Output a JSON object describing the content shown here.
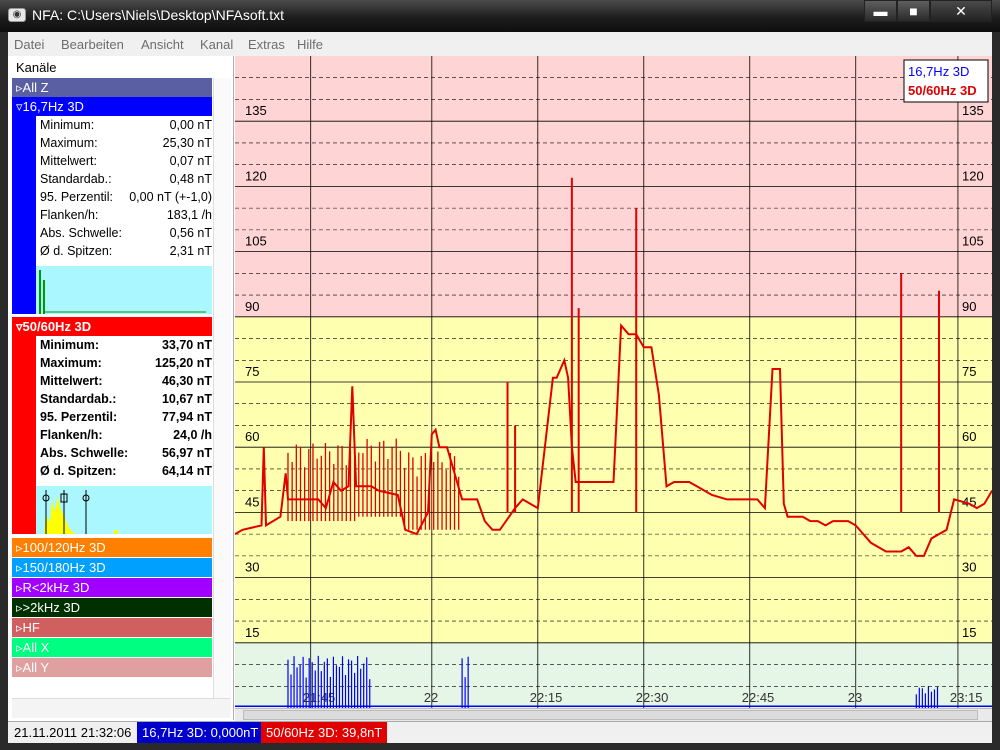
{
  "window": {
    "title": "NFA: C:\\Users\\Niels\\Desktop\\NFAsoft.txt",
    "min_glyph": "▬",
    "max_glyph": "■",
    "close_glyph": "✕"
  },
  "menu": [
    "Datei",
    "Bearbeiten",
    "Ansicht",
    "Kanal",
    "Extras",
    "Hilfe"
  ],
  "sidebar": {
    "header": "Kanäle",
    "channels": [
      {
        "label": "▹All Z",
        "color": "#5a5fa3"
      },
      {
        "label": "▿16,7Hz 3D",
        "color": "#0000ff",
        "expanded": true,
        "stats": [
          [
            "Minimum:",
            "0,00 nT"
          ],
          [
            "Maximum:",
            "25,30 nT"
          ],
          [
            "Mittelwert:",
            "0,07 nT"
          ],
          [
            "Standardab.:",
            "0,48 nT"
          ],
          [
            "95. Perzentil:",
            "0,00 nT (+-1,0)"
          ],
          [
            "Flanken/h:",
            "183,1 /h"
          ],
          [
            "Abs. Schwelle:",
            "0,56 nT"
          ],
          [
            "Ø d. Spitzen:",
            "2,31 nT"
          ]
        ]
      },
      {
        "label": "▿50/60Hz 3D",
        "color": "#ff0000",
        "expanded": true,
        "bold": true,
        "stats": [
          [
            "Minimum:",
            "33,70 nT"
          ],
          [
            "Maximum:",
            "125,20 nT"
          ],
          [
            "Mittelwert:",
            "46,30 nT"
          ],
          [
            "Standardab.:",
            "10,67 nT"
          ],
          [
            "95. Perzentil:",
            "77,94 nT"
          ],
          [
            "Flanken/h:",
            "24,0 /h"
          ],
          [
            "Abs. Schwelle:",
            "56,97 nT"
          ],
          [
            "Ø d. Spitzen:",
            "64,14 nT"
          ]
        ]
      },
      {
        "label": "▹100/120Hz 3D",
        "color": "#ff7f00"
      },
      {
        "label": "▹150/180Hz 3D",
        "color": "#00a0ff"
      },
      {
        "label": "▹R<2kHz 3D",
        "color": "#a000ff"
      },
      {
        "label": "▹>2kHz 3D",
        "color": "#003000"
      },
      {
        "label": "▹HF",
        "color": "#d06060"
      },
      {
        "label": "▹All X",
        "color": "#00ff80"
      },
      {
        "label": "▹All Y",
        "color": "#e0a0a0"
      }
    ]
  },
  "chart_data": {
    "type": "line",
    "ylim": [
      0,
      150
    ],
    "y_ticks": [
      15,
      30,
      45,
      60,
      75,
      90,
      105,
      120,
      135
    ],
    "x_ticks": [
      "21:45",
      "22",
      "22:15",
      "22:30",
      "22:45",
      "23",
      "23:15"
    ],
    "bands": [
      {
        "from": 0,
        "to": 15,
        "color": "#e6f6e6"
      },
      {
        "from": 15,
        "to": 90,
        "color": "#ffffb0"
      },
      {
        "from": 90,
        "to": 150,
        "color": "#ffd4d4"
      }
    ],
    "legend": [
      "16,7Hz 3D",
      "50/60Hz 3D"
    ],
    "series": [
      {
        "name": "16,7Hz 3D",
        "color": "#0000ff",
        "base": [
          [
            0,
            0.2
          ],
          [
            1,
            0.2
          ]
        ],
        "spikes": [
          [
            0.07,
            0.18,
            12
          ],
          [
            0.3,
            0.31,
            12
          ],
          [
            0.9,
            0.93,
            5
          ]
        ]
      },
      {
        "name": "50/60Hz 3D",
        "color": "#e00000",
        "points": [
          [
            0,
            40
          ],
          [
            0.01,
            41
          ],
          [
            0.035,
            42
          ],
          [
            0.038,
            60
          ],
          [
            0.041,
            42
          ],
          [
            0.06,
            44
          ],
          [
            0.067,
            54
          ],
          [
            0.07,
            48
          ],
          [
            0.09,
            48
          ],
          [
            0.11,
            48
          ],
          [
            0.12,
            46
          ],
          [
            0.13,
            52
          ],
          [
            0.14,
            50
          ],
          [
            0.15,
            51
          ],
          [
            0.155,
            74
          ],
          [
            0.16,
            51
          ],
          [
            0.18,
            51
          ],
          [
            0.19,
            50
          ],
          [
            0.215,
            49
          ],
          [
            0.225,
            41
          ],
          [
            0.24,
            40
          ],
          [
            0.255,
            45
          ],
          [
            0.26,
            63
          ],
          [
            0.265,
            64
          ],
          [
            0.27,
            60
          ],
          [
            0.28,
            60
          ],
          [
            0.3,
            48
          ],
          [
            0.32,
            48
          ],
          [
            0.33,
            43
          ],
          [
            0.34,
            41
          ],
          [
            0.35,
            41
          ],
          [
            0.37,
            46
          ],
          [
            0.38,
            48
          ],
          [
            0.39,
            47
          ],
          [
            0.4,
            46
          ],
          [
            0.42,
            76
          ],
          [
            0.425,
            76
          ],
          [
            0.43,
            78
          ],
          [
            0.435,
            80
          ],
          [
            0.44,
            76
          ],
          [
            0.445,
            60
          ],
          [
            0.45,
            52
          ],
          [
            0.47,
            52
          ],
          [
            0.49,
            52
          ],
          [
            0.5,
            52
          ],
          [
            0.51,
            88
          ],
          [
            0.52,
            86
          ],
          [
            0.53,
            86
          ],
          [
            0.54,
            83
          ],
          [
            0.55,
            83
          ],
          [
            0.56,
            72
          ],
          [
            0.57,
            51
          ],
          [
            0.58,
            52
          ],
          [
            0.6,
            52
          ],
          [
            0.61,
            51
          ],
          [
            0.63,
            49
          ],
          [
            0.65,
            48
          ],
          [
            0.67,
            48
          ],
          [
            0.69,
            48
          ],
          [
            0.7,
            46
          ],
          [
            0.71,
            78
          ],
          [
            0.72,
            78
          ],
          [
            0.725,
            47
          ],
          [
            0.73,
            44
          ],
          [
            0.75,
            44
          ],
          [
            0.76,
            43
          ],
          [
            0.77,
            43
          ],
          [
            0.78,
            42
          ],
          [
            0.79,
            43
          ],
          [
            0.8,
            43
          ],
          [
            0.81,
            43
          ],
          [
            0.82,
            42
          ],
          [
            0.84,
            38
          ],
          [
            0.86,
            36
          ],
          [
            0.88,
            36
          ],
          [
            0.89,
            37
          ],
          [
            0.9,
            35
          ],
          [
            0.91,
            35
          ],
          [
            0.92,
            39
          ],
          [
            0.93,
            40
          ],
          [
            0.94,
            41
          ],
          [
            0.95,
            48
          ],
          [
            0.97,
            47
          ],
          [
            0.98,
            46
          ],
          [
            0.99,
            47
          ],
          [
            1,
            50
          ]
        ],
        "spikes": [
          [
            0.36,
            0.37,
            75
          ],
          [
            0.37,
            0.375,
            65
          ],
          [
            0.445,
            0.45,
            122
          ],
          [
            0.454,
            0.46,
            92
          ],
          [
            0.53,
            0.535,
            115
          ],
          [
            0.88,
            0.885,
            100
          ],
          [
            0.93,
            0.935,
            96
          ]
        ]
      }
    ]
  },
  "status": {
    "datetime": "21.11.2011 21:32:06",
    "ch1": "16,7Hz 3D: 0,000nT",
    "ch2": "50/60Hz 3D: 39,8nT"
  }
}
